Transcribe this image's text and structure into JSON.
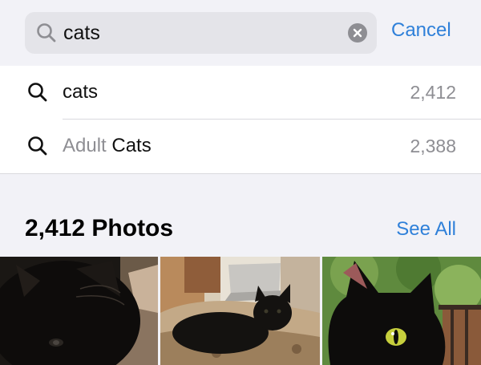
{
  "search": {
    "query": "cats",
    "cancel_label": "Cancel"
  },
  "suggestions": [
    {
      "prefix": "",
      "label": "cats",
      "count": "2,412"
    },
    {
      "prefix": "Adult ",
      "label": "Cats",
      "count": "2,388"
    }
  ],
  "photos": {
    "title": "2,412 Photos",
    "see_all_label": "See All"
  },
  "icons": {
    "search": "search-icon",
    "clear": "clear-icon",
    "suggestion": "search-icon"
  },
  "colors": {
    "accent": "#2f80d9",
    "background": "#f2f2f7",
    "secondary_text": "#8e8e93"
  }
}
